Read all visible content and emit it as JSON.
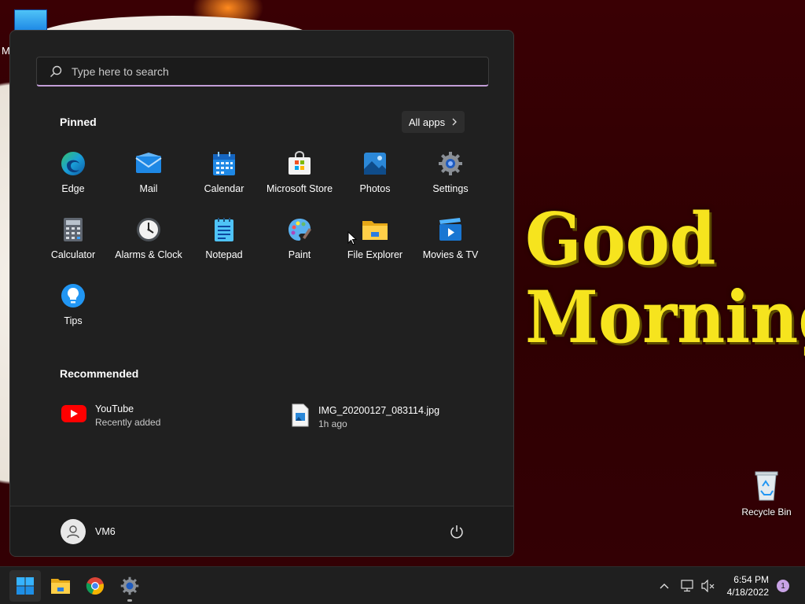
{
  "desktop": {
    "greeting_line1": "Good",
    "greeting_line2": "Morning",
    "partial_label": "M",
    "recycle_bin_label": "Recycle Bin"
  },
  "start_menu": {
    "search": {
      "placeholder": "Type here to search"
    },
    "pinned_title": "Pinned",
    "all_apps_label": "All apps",
    "pinned_apps": [
      {
        "label": "Edge",
        "icon": "edge-icon"
      },
      {
        "label": "Mail",
        "icon": "mail-icon"
      },
      {
        "label": "Calendar",
        "icon": "calendar-icon"
      },
      {
        "label": "Microsoft Store",
        "icon": "store-icon"
      },
      {
        "label": "Photos",
        "icon": "photos-icon"
      },
      {
        "label": "Settings",
        "icon": "settings-icon"
      },
      {
        "label": "Calculator",
        "icon": "calculator-icon"
      },
      {
        "label": "Alarms & Clock",
        "icon": "clock-icon"
      },
      {
        "label": "Notepad",
        "icon": "notepad-icon"
      },
      {
        "label": "Paint",
        "icon": "paint-icon"
      },
      {
        "label": "File Explorer",
        "icon": "folder-icon"
      },
      {
        "label": "Movies & TV",
        "icon": "movies-icon"
      },
      {
        "label": "Tips",
        "icon": "tips-icon"
      }
    ],
    "recommended_title": "Recommended",
    "recommended": [
      {
        "title": "YouTube",
        "subtitle": "Recently added",
        "icon": "youtube-icon"
      },
      {
        "title": "IMG_20200127_083114.jpg",
        "subtitle": "1h ago",
        "icon": "image-file-icon"
      }
    ],
    "user_name": "VM6"
  },
  "taskbar": {
    "time": "6:54 PM",
    "date": "4/18/2022",
    "notification_count": "1",
    "pinned": [
      "start-icon",
      "file-explorer-icon",
      "chrome-icon",
      "settings-icon"
    ]
  },
  "colors": {
    "accent": "#c39ed8",
    "menu_bg": "#202020",
    "greeting": "#f6e41e"
  }
}
